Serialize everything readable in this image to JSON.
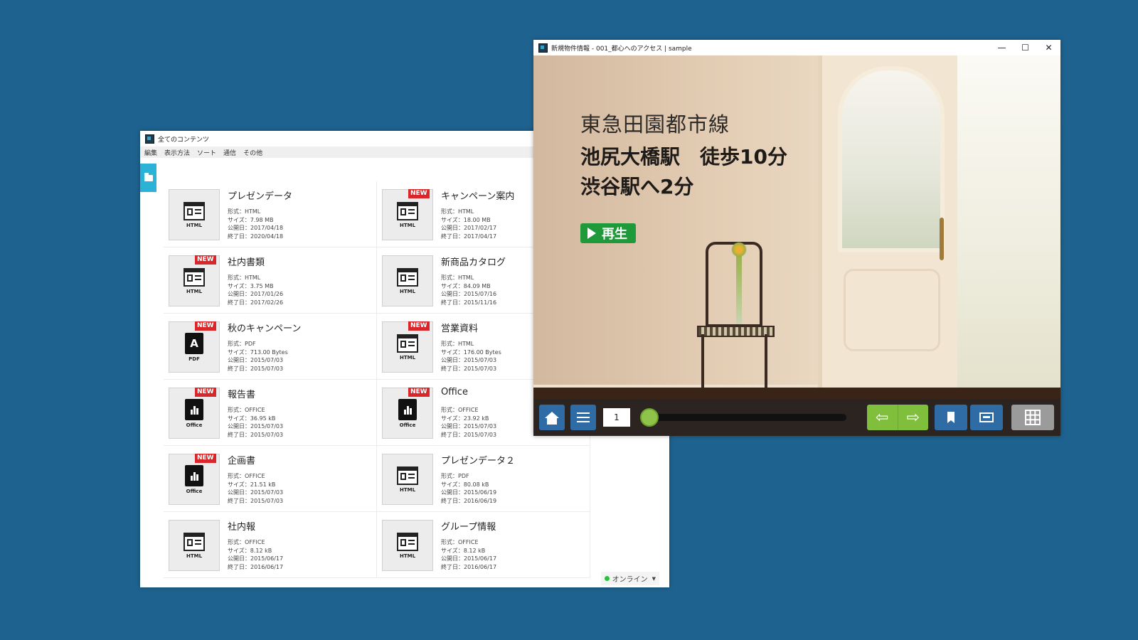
{
  "desktop": {
    "background": "#1e6390"
  },
  "list_window": {
    "title": "全てのコンテンツ",
    "menu": [
      "編集",
      "表示方法",
      "ソート",
      "通信",
      "その他"
    ],
    "items": [
      {
        "title": "プレゼンデータ",
        "type": "HTML",
        "is_new": false,
        "meta": [
          "形式：HTML",
          "サイズ：7.98 MB",
          "公開日：2017/04/18",
          "終了日：2020/04/18"
        ]
      },
      {
        "title": "キャンペーン案内",
        "type": "HTML",
        "is_new": true,
        "meta": [
          "形式：HTML",
          "サイズ：18.00 MB",
          "公開日：2017/02/17",
          "終了日：2017/04/17"
        ]
      },
      {
        "title": "社内書類",
        "type": "HTML",
        "is_new": true,
        "meta": [
          "形式：HTML",
          "サイズ：3.75 MB",
          "公開日：2017/01/26",
          "終了日：2017/02/26"
        ]
      },
      {
        "title": "新商品カタログ",
        "type": "HTML",
        "is_new": false,
        "meta": [
          "形式：HTML",
          "サイズ：84.09 MB",
          "公開日：2015/07/16",
          "終了日：2015/11/16"
        ]
      },
      {
        "title": "秋のキャンペーン",
        "type": "PDF",
        "is_new": true,
        "meta": [
          "形式：PDF",
          "サイズ：713.00 Bytes",
          "公開日：2015/07/03",
          "終了日：2015/07/03"
        ]
      },
      {
        "title": "営業資料",
        "type": "HTML",
        "is_new": true,
        "meta": [
          "形式：HTML",
          "サイズ：176.00 Bytes",
          "公開日：2015/07/03",
          "終了日：2015/07/03"
        ]
      },
      {
        "title": "報告書",
        "type": "Office",
        "is_new": true,
        "meta": [
          "形式：OFFICE",
          "サイズ：36.95 kB",
          "公開日：2015/07/03",
          "終了日：2015/07/03"
        ]
      },
      {
        "title": "Office",
        "type": "Office",
        "is_new": true,
        "meta": [
          "形式：OFFICE",
          "サイズ：23.92 kB",
          "公開日：2015/07/03",
          "終了日：2015/07/03"
        ]
      },
      {
        "title": "企画書",
        "type": "Office",
        "is_new": true,
        "meta": [
          "形式：OFFICE",
          "サイズ：21.51 kB",
          "公開日：2015/07/03",
          "終了日：2015/07/03"
        ]
      },
      {
        "title": "プレゼンデータ２",
        "type": "HTML",
        "is_new": false,
        "meta": [
          "形式：PDF",
          "サイズ：80.08 kB",
          "公開日：2015/06/19",
          "終了日：2016/06/19"
        ]
      },
      {
        "title": "社内報",
        "type": "HTML",
        "is_new": false,
        "meta": [
          "形式：OFFICE",
          "サイズ：8.12 kB",
          "公開日：2015/06/17",
          "終了日：2016/06/17"
        ]
      },
      {
        "title": "グループ情報",
        "type": "HTML",
        "is_new": false,
        "meta": [
          "形式：OFFICE",
          "サイズ：8.12 kB",
          "公開日：2015/06/17",
          "終了日：2016/06/17"
        ]
      }
    ],
    "new_badge": "NEW",
    "status": {
      "label": "オンライン",
      "color": "#28c23c"
    }
  },
  "viewer_window": {
    "title": "新規物件情報 - 001_都心へのアクセス | sample",
    "controls": {
      "minimize": "—",
      "maximize": "☐",
      "close": "✕"
    },
    "slide": {
      "station_line": "東急田園都市線",
      "headline_1": "池尻大橋駅　徒歩10分",
      "headline_2": "渋谷駅へ2分",
      "play_label": "再生"
    },
    "toolbar": {
      "page_number": "1",
      "progress_fraction": 0.0,
      "prev_glyph": "⇦",
      "next_glyph": "⇨",
      "icons": [
        "home-icon",
        "list-icon",
        "bookmark-icon",
        "card-icon",
        "grid-icon"
      ]
    }
  }
}
